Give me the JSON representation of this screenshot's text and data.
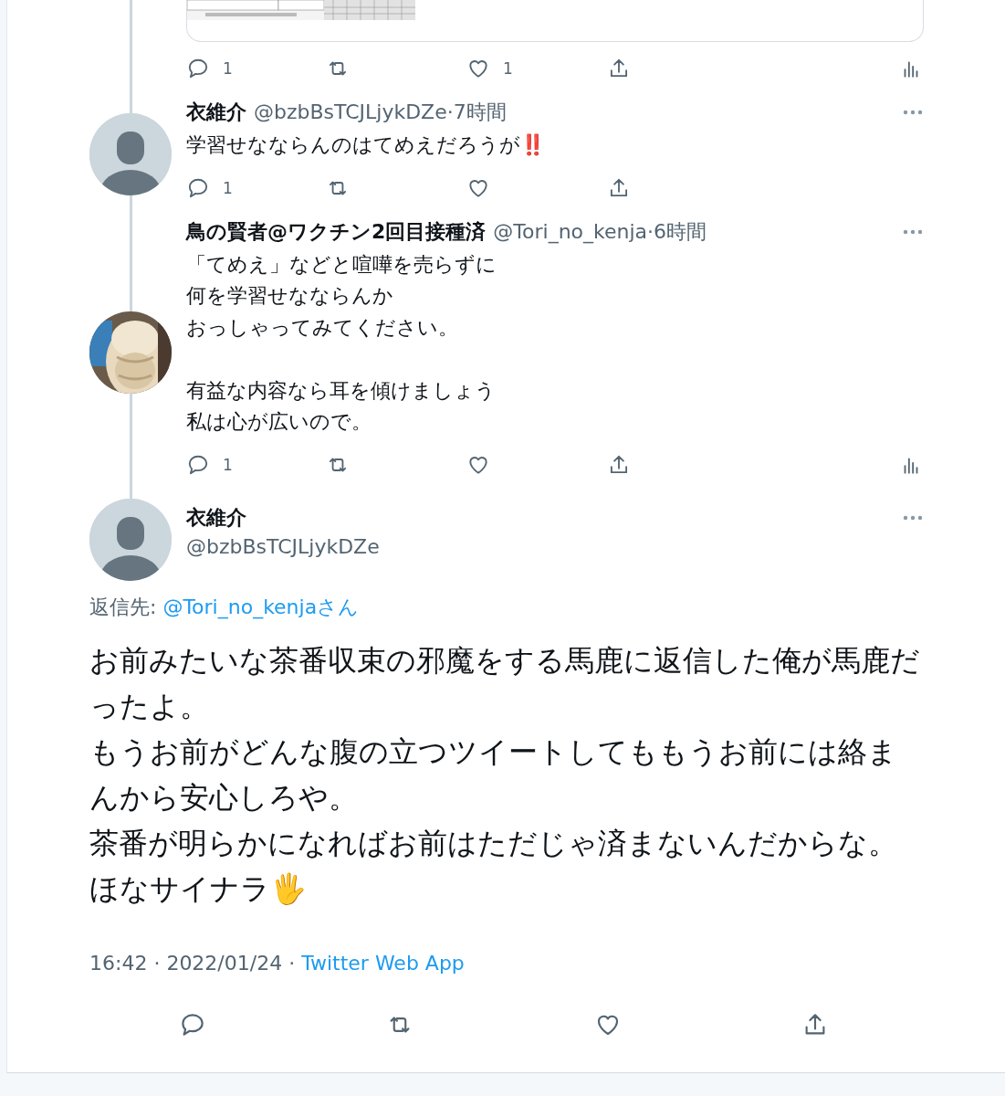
{
  "previous_tweet": {
    "actions": {
      "reply_count": "1",
      "like_count": "1",
      "analytics": true
    }
  },
  "replies": [
    {
      "avatar": {
        "kind": "silhouette"
      },
      "name": "衣維介",
      "handle_time": "@bzbBsTCJLjykDZe·7時間",
      "paragraphs": [
        [
          "学習せなならんのはてめえだろうが‼️"
        ]
      ],
      "actions": {
        "reply_count": "1",
        "analytics": false
      }
    },
    {
      "avatar": {
        "kind": "picture"
      },
      "name": "鳥の賢者@ワクチン2回目接種済",
      "handle_time": "@Tori_no_kenja·6時間",
      "paragraphs": [
        [
          "「てめえ」などと喧嘩を売らずに",
          "何を学習せなならんか",
          "おっしゃってみてください。"
        ],
        [
          "有益な内容なら耳を傾けましょう",
          "私は心が広いので。"
        ]
      ],
      "actions": {
        "reply_count": "1",
        "analytics": true
      }
    }
  ],
  "main_tweet": {
    "name": "衣維介",
    "handle": "@bzbBsTCJLjykDZe",
    "reply_to_label": "返信先: ",
    "reply_to_link": "@Tori_no_kenjaさん",
    "lines": [
      "お前みたいな茶番収束の邪魔をする馬鹿に返信した俺が馬鹿だったよ。",
      "もうお前がどんな腹の立つツイートしてももうお前には絡まんから安心しろや。",
      "茶番が明らかになればお前はただじゃ済まないんだからな。",
      "ほなサイナラ🖐"
    ],
    "date": "16:42 · 2022/01/24 · ",
    "source": "Twitter Web App"
  }
}
